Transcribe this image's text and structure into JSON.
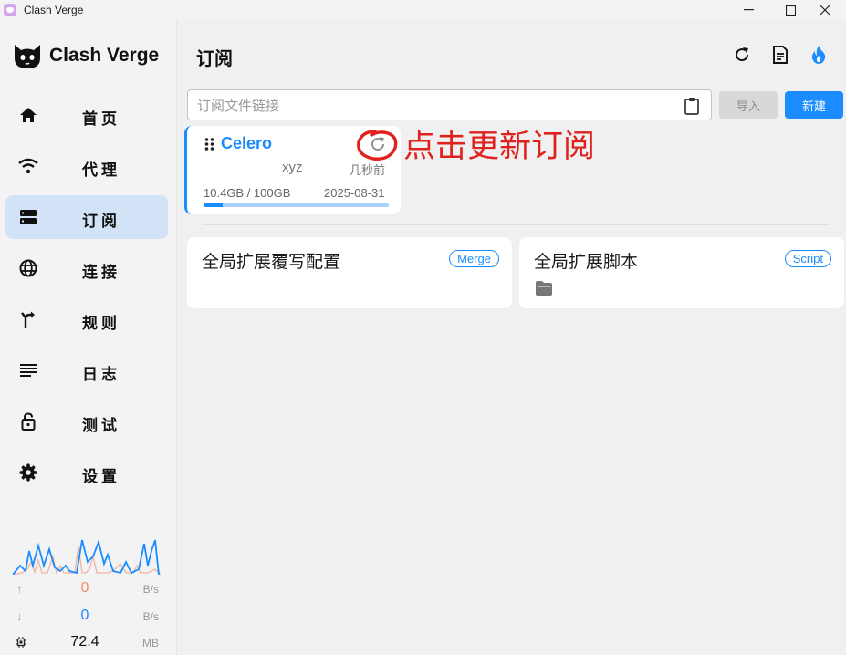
{
  "window": {
    "title": "Clash Verge",
    "controls": [
      "minimize",
      "maximize",
      "close"
    ]
  },
  "sidebar": {
    "logo_text": "Clash Verge",
    "items": [
      {
        "label": "首页",
        "icon": "home-icon",
        "active": false
      },
      {
        "label": "代理",
        "icon": "wifi-icon",
        "active": false
      },
      {
        "label": "订阅",
        "icon": "storage-icon",
        "active": true
      },
      {
        "label": "连接",
        "icon": "globe-icon",
        "active": false
      },
      {
        "label": "规则",
        "icon": "fork-icon",
        "active": false
      },
      {
        "label": "日志",
        "icon": "lines-icon",
        "active": false
      },
      {
        "label": "测试",
        "icon": "lock-icon",
        "active": false
      },
      {
        "label": "设置",
        "icon": "gear-icon",
        "active": false
      }
    ],
    "traffic": {
      "upload": {
        "value": "0",
        "unit": "B/s",
        "color": "#f28b6b"
      },
      "download": {
        "value": "0",
        "unit": "B/s",
        "color": "#1a8cff"
      },
      "memory": {
        "value": "72.4",
        "unit": "MB"
      }
    }
  },
  "header": {
    "title": "订阅",
    "icons": [
      "refresh-icon",
      "document-icon",
      "flame-icon"
    ]
  },
  "import_bar": {
    "placeholder": "订阅文件链接",
    "import_label": "导入",
    "new_label": "新建"
  },
  "profile": {
    "name": "Celero",
    "desc": "xyz",
    "updated": "几秒前",
    "usage": "10.4GB / 100GB",
    "expire": "2025-08-31",
    "usage_fraction": 0.104
  },
  "annotation": {
    "text": "点击更新订阅",
    "color": "#e0221e"
  },
  "extensions": [
    {
      "title": "全局扩展覆写配置",
      "tag": "Merge"
    },
    {
      "title": "全局扩展脚本",
      "tag": "Script"
    }
  ],
  "colors": {
    "accent": "#1a8cff",
    "active_bg": "#d3e3f7",
    "annotation": "#e0221e"
  }
}
